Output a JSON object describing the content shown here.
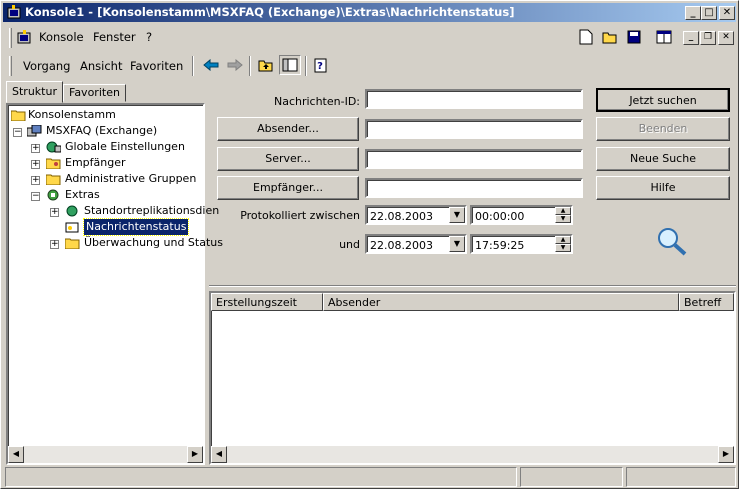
{
  "window": {
    "title": "Konsole1 - [Konsolenstamm\\MSXFAQ (Exchange)\\Extras\\Nachrichtenstatus]",
    "icon": "mmc-icon"
  },
  "menu": {
    "items": [
      {
        "label": "Konsole",
        "icon": "console-icon"
      },
      {
        "label": "Fenster"
      },
      {
        "label": "?"
      }
    ]
  },
  "action_menu": {
    "items": [
      {
        "label": "Vorgang"
      },
      {
        "label": "Ansicht"
      },
      {
        "label": "Favoriten"
      }
    ]
  },
  "tabs": [
    {
      "label": "Struktur",
      "active": true
    },
    {
      "label": "Favoriten",
      "active": false
    }
  ],
  "tree": {
    "nodes": [
      {
        "label": "Konsolenstamm",
        "icon": "folder-icon",
        "level": 0
      },
      {
        "label": "MSXFAQ (Exchange)",
        "icon": "exchange-org-icon",
        "level": 1,
        "expander": "-"
      },
      {
        "label": "Globale Einstellungen",
        "icon": "globe-settings-icon",
        "level": 2,
        "expander": "+"
      },
      {
        "label": "Empfänger",
        "icon": "recipients-folder-icon",
        "level": 2,
        "expander": "+"
      },
      {
        "label": "Administrative Gruppen",
        "icon": "folder-icon",
        "level": 2,
        "expander": "+"
      },
      {
        "label": "Extras",
        "icon": "tools-icon",
        "level": 2,
        "expander": "-"
      },
      {
        "label": "Standortreplikationsdien",
        "icon": "globe-icon",
        "level": 3,
        "expander": "+"
      },
      {
        "label": "Nachrichtenstatus",
        "icon": "message-tracking-icon",
        "level": 3,
        "selected": true
      },
      {
        "label": "Überwachung und Status",
        "icon": "folder-icon",
        "level": 3,
        "expander": "+"
      }
    ]
  },
  "form": {
    "message_id_label": "Nachrichten-ID:",
    "message_id_value": "",
    "sender_button": "Absender...",
    "sender_value": "",
    "server_button": "Server...",
    "server_value": "",
    "recipient_button": "Empfänger...",
    "recipient_value": "",
    "logged_between_label": "Protokolliert zwischen",
    "and_label": "und",
    "from_date": "22.08.2003",
    "from_time": "00:00:00",
    "to_date": "22.08.2003",
    "to_time": "17:59:25"
  },
  "actions": {
    "search_now": "Jetzt suchen",
    "stop": "Beenden",
    "new_search": "Neue Suche",
    "help": "Hilfe"
  },
  "results": {
    "columns": [
      "Erstellungszeit",
      "Absender",
      "Betreff"
    ],
    "rows": []
  },
  "colors": {
    "title_start": "#0a246a",
    "title_end": "#a6caf0",
    "selection": "#0a246a",
    "face": "#d4d0c8"
  }
}
